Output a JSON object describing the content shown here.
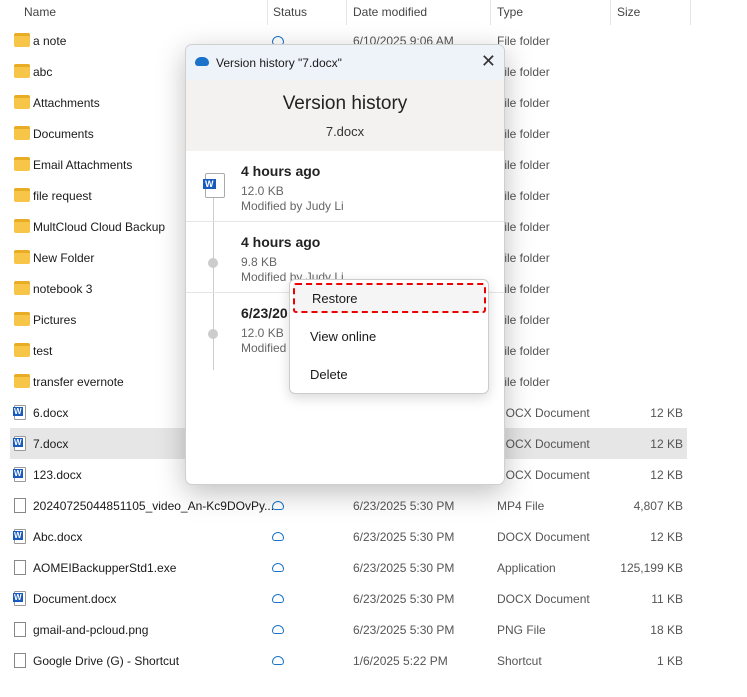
{
  "columns": {
    "name": "Name",
    "status": "Status",
    "date": "Date modified",
    "type": "Type",
    "size": "Size"
  },
  "files": [
    {
      "name": "a note",
      "icon": "folder",
      "status": "cloud",
      "date": "6/10/2025 9:06 AM",
      "type": "File folder",
      "size": ""
    },
    {
      "name": "abc",
      "icon": "folder",
      "status": "",
      "date": "",
      "type": "File folder",
      "size": ""
    },
    {
      "name": "Attachments",
      "icon": "folder",
      "status": "",
      "date": "",
      "type": "File folder",
      "size": ""
    },
    {
      "name": "Documents",
      "icon": "folder",
      "status": "",
      "date": "",
      "type": "File folder",
      "size": ""
    },
    {
      "name": "Email Attachments",
      "icon": "folder",
      "status": "",
      "date": "",
      "type": "File folder",
      "size": ""
    },
    {
      "name": "file request",
      "icon": "folder",
      "status": "",
      "date": "",
      "type": "File folder",
      "size": ""
    },
    {
      "name": "MultCloud Cloud Backup",
      "icon": "folder",
      "status": "",
      "date": "",
      "type": "File folder",
      "size": ""
    },
    {
      "name": "New Folder",
      "icon": "folder",
      "status": "",
      "date": "",
      "type": "File folder",
      "size": ""
    },
    {
      "name": "notebook 3",
      "icon": "folder",
      "status": "",
      "date": "",
      "type": "File folder",
      "size": ""
    },
    {
      "name": "Pictures",
      "icon": "folder",
      "status": "",
      "date": "",
      "type": "File folder",
      "size": ""
    },
    {
      "name": "test",
      "icon": "folder",
      "status": "",
      "date": "",
      "type": "File folder",
      "size": ""
    },
    {
      "name": "transfer evernote",
      "icon": "folder",
      "status": "",
      "date": "",
      "type": "File folder",
      "size": ""
    },
    {
      "name": "6.docx",
      "icon": "word",
      "status": "",
      "date": "",
      "type": "DOCX Document",
      "size": "12 KB"
    },
    {
      "name": "7.docx",
      "icon": "word",
      "status": "",
      "date": "",
      "type": "DOCX Document",
      "size": "12 KB",
      "selected": true
    },
    {
      "name": "123.docx",
      "icon": "word",
      "status": "",
      "date": "",
      "type": "DOCX Document",
      "size": "12 KB"
    },
    {
      "name": "20240725044851105_video_An-Kc9DOvPy...",
      "icon": "video",
      "status": "cloud",
      "date": "6/23/2025 5:30 PM",
      "type": "MP4 File",
      "size": "4,807 KB"
    },
    {
      "name": "Abc.docx",
      "icon": "word",
      "status": "cloud",
      "date": "6/23/2025 5:30 PM",
      "type": "DOCX Document",
      "size": "12 KB"
    },
    {
      "name": "AOMEIBackupperStd1.exe",
      "icon": "exe",
      "status": "cloud",
      "date": "6/23/2025 5:30 PM",
      "type": "Application",
      "size": "125,199 KB"
    },
    {
      "name": "Document.docx",
      "icon": "word",
      "status": "cloud",
      "date": "6/23/2025 5:30 PM",
      "type": "DOCX Document",
      "size": "11 KB"
    },
    {
      "name": "gmail-and-pcloud.png",
      "icon": "image",
      "status": "cloud",
      "date": "6/23/2025 5:30 PM",
      "type": "PNG File",
      "size": "18 KB"
    },
    {
      "name": "Google Drive (G) - Shortcut",
      "icon": "shortcut",
      "status": "cloud",
      "date": "1/6/2025 5:22 PM",
      "type": "Shortcut",
      "size": "1 KB"
    }
  ],
  "dialog": {
    "title": "Version history \"7.docx\"",
    "heading": "Version history",
    "filename": "7.docx",
    "versions": [
      {
        "when": "4 hours ago",
        "size": "12.0 KB",
        "by": "Modified by Judy Li"
      },
      {
        "when": "4 hours ago",
        "size": "9.8 KB",
        "by": "Modified by Judy Li"
      },
      {
        "when": "6/23/20",
        "size": "12.0 KB",
        "by": "Modified"
      }
    ]
  },
  "menu": {
    "restore": "Restore",
    "view_online": "View online",
    "delete": "Delete"
  }
}
